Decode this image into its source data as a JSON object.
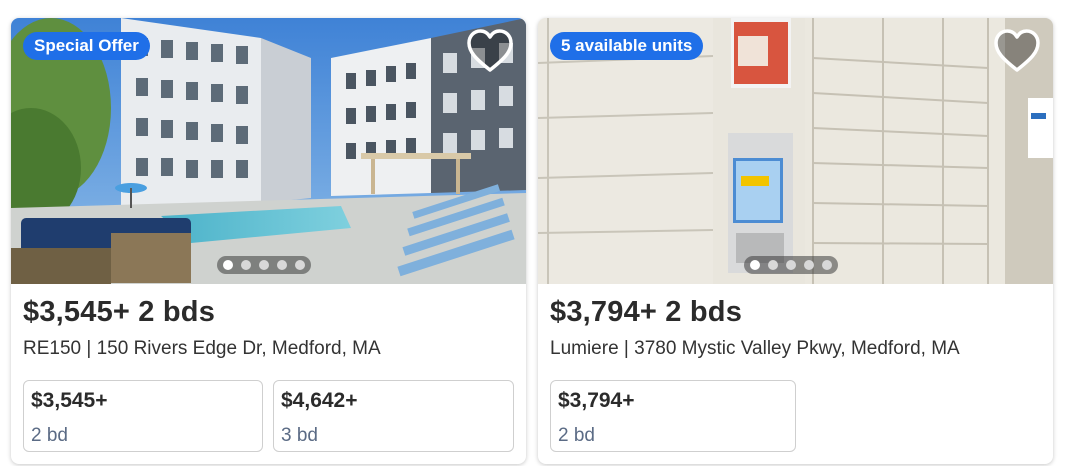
{
  "listings": [
    {
      "badge": "Special Offer",
      "price_line": "$3,545+ 2 bds",
      "address": "RE150 | 150 Rivers Edge Dr, Medford, MA",
      "units": [
        {
          "price": "$3,545+",
          "beds": "2 bd"
        },
        {
          "price": "$4,642+",
          "beds": "3 bd"
        }
      ],
      "carousel": {
        "total": 5,
        "active": 1
      },
      "photo_icon": "apartment-pool-photo"
    },
    {
      "badge": "5 available units",
      "price_line": "$3,794+ 2 bds",
      "address": "Lumiere | 3780 Mystic Valley Pkwy, Medford, MA",
      "units": [
        {
          "price": "$3,794+",
          "beds": "2 bd"
        }
      ],
      "carousel": {
        "total": 5,
        "active": 1
      },
      "photo_icon": "package-locker-photo"
    }
  ],
  "colors": {
    "badge": "#1f6fe8",
    "price_text": "#2b2b2b",
    "beds_text": "#5b6b85"
  }
}
